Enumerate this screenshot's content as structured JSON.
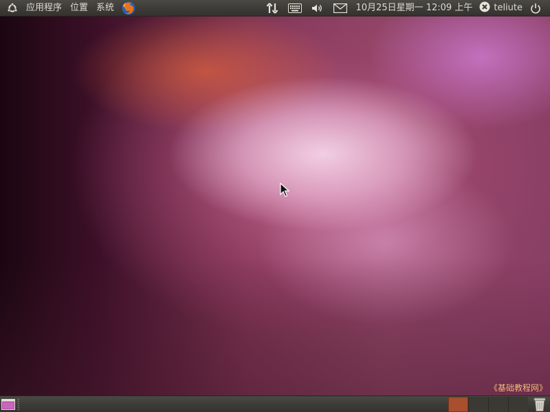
{
  "top_panel": {
    "menus": {
      "applications": "应用程序",
      "places": "位置",
      "system": "系统"
    },
    "clock": "10月25日星期一 12:09 上午",
    "user": "teliute",
    "icons": [
      "ubuntu-logo-icon",
      "firefox-icon",
      "network-icon",
      "keyboard-icon",
      "volume-icon",
      "mail-icon",
      "user-status-icon",
      "power-icon"
    ]
  },
  "bottom_panel": {
    "workspaces": [
      {
        "active": true
      },
      {
        "active": false
      },
      {
        "active": false
      },
      {
        "active": false
      }
    ],
    "icons": [
      "show-desktop-icon",
      "trash-icon"
    ]
  },
  "watermark": "《基础教程网》",
  "colors": {
    "panel": "#3c3b37",
    "panel_text": "#dfdbd2",
    "active_workspace": "#a94f2e",
    "watermark": "#f2bb8a"
  }
}
